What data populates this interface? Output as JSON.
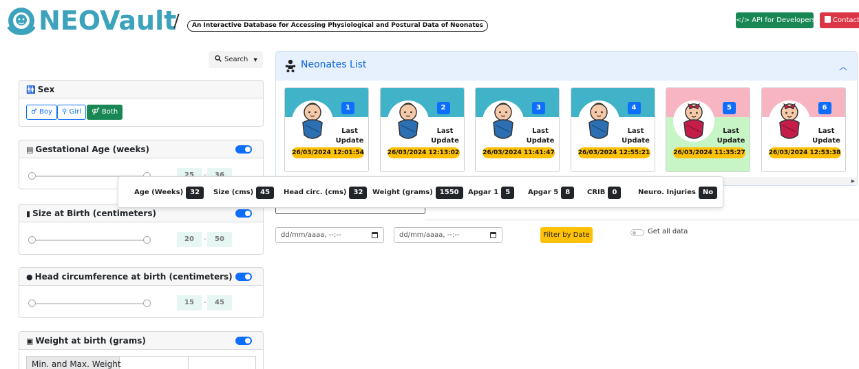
{
  "header": {
    "logo_text": "NEOVault",
    "separator": "/",
    "tagline": "An Interactive Database for Accessing Physiological and Postural Data of Neonates",
    "api_button": "</> API for Developers",
    "contact_button": "Contact"
  },
  "search": {
    "label": "Search"
  },
  "filters": {
    "sex": {
      "title": "Sex",
      "boy": "♂ Boy",
      "girl": "⚲ Girl",
      "both": "⚤ Both"
    },
    "gestational_age": {
      "title": "Gestational Age (weeks)",
      "min": "25",
      "max": "36"
    },
    "size": {
      "title": "Size at Birth (centimeters)",
      "min": "20",
      "max": "50"
    },
    "head_circ": {
      "title": "Head circumference at birth (centimeters)",
      "min": "15",
      "max": "45"
    },
    "weight": {
      "title": "Weight at birth (grams)",
      "table_header": "Min. and Max. Weight"
    }
  },
  "range_separator": "-",
  "neonates": {
    "title": "Neonates List",
    "last_update_label": "Last Update",
    "cards": [
      {
        "id": "1",
        "sex": "boy",
        "date": "26/03/2024 12:01:54"
      },
      {
        "id": "2",
        "sex": "boy",
        "date": "26/03/2024 12:13:02"
      },
      {
        "id": "3",
        "sex": "boy",
        "date": "26/03/2024 11:41:47"
      },
      {
        "id": "4",
        "sex": "boy",
        "date": "26/03/2024 12:55:21"
      },
      {
        "id": "5",
        "sex": "girl",
        "date": "26/03/2024 11:35:27",
        "selected": true
      },
      {
        "id": "6",
        "sex": "girl",
        "date": "26/03/2024 12:53:38"
      }
    ]
  },
  "details": {
    "age": {
      "label": "Age (Weeks)",
      "value": "32"
    },
    "size": {
      "label": "Size (cms)",
      "value": "45"
    },
    "head": {
      "label": "Head circ. (cms)",
      "value": "32"
    },
    "weight": {
      "label": "Weight (grams)",
      "value": "1550"
    },
    "apgar1": {
      "label": "Apgar 1",
      "value": "5"
    },
    "apgar5": {
      "label": "Apgar 5",
      "value": "8"
    },
    "crib": {
      "label": "CRIB",
      "value": "0"
    },
    "neuro": {
      "label": "Neuro. Injuries",
      "value": "No"
    }
  },
  "date_filter": {
    "start_placeholder": "dd/mm/aaaa, --:--",
    "end_placeholder": "dd/mm/aaaa, --:--",
    "filter_button": "Filter by Date",
    "get_all_label": "Get all data"
  },
  "colors": {
    "brand": "#3da3bd",
    "boy_card": "#40b3c9",
    "girl_card": "#f7b5c2",
    "selected_card": "#c8f5c5",
    "accent_blue": "#0d6efd",
    "green_button": "#198754",
    "red_button": "#dc3545",
    "yellow_badge": "#ffc107"
  }
}
